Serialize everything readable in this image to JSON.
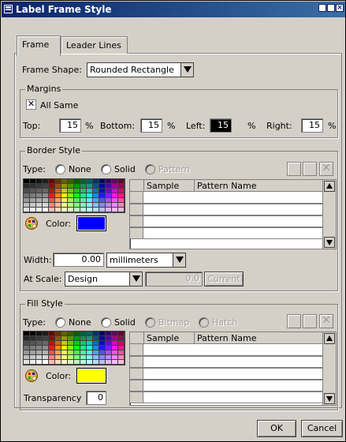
{
  "window": {
    "title": "Label Frame Style"
  },
  "tabs": [
    {
      "label": "Frame"
    },
    {
      "label": "Leader Lines"
    }
  ],
  "frame": {
    "shape_label": "Frame Shape:",
    "shape_value": "Rounded Rectangle"
  },
  "margins": {
    "caption": "Margins",
    "all_same_label": "All Same",
    "all_same_checked": true,
    "top_label": "Top:",
    "top_value": "15",
    "bottom_label": "Bottom:",
    "bottom_value": "15",
    "left_label": "Left:",
    "left_value": "15",
    "right_label": "Right:",
    "right_value": "15",
    "unit": "%"
  },
  "border": {
    "caption": "Border Style",
    "type_label": "Type:",
    "types": [
      "None",
      "Solid",
      "Pattern"
    ],
    "color_label": "Color:",
    "color": "#0000ff",
    "grid_headers": [
      "Sample",
      "Pattern Name"
    ],
    "width_label": "Width:",
    "width_value": "0.00",
    "width_unit": "millimeters",
    "scale_label": "At Scale:",
    "scale_value": "Design",
    "scale_number": "0.0",
    "current_label": "Current"
  },
  "fill": {
    "caption": "Fill Style",
    "type_label": "Type:",
    "types": [
      "None",
      "Solid",
      "Bitmap",
      "Hatch"
    ],
    "color_label": "Color:",
    "color": "#ffff00",
    "grid_headers": [
      "Sample",
      "Pattern Name"
    ],
    "transparency_label": "Transparency",
    "transparency_value": "0"
  },
  "buttons": {
    "ok": "OK",
    "cancel": "Cancel"
  }
}
